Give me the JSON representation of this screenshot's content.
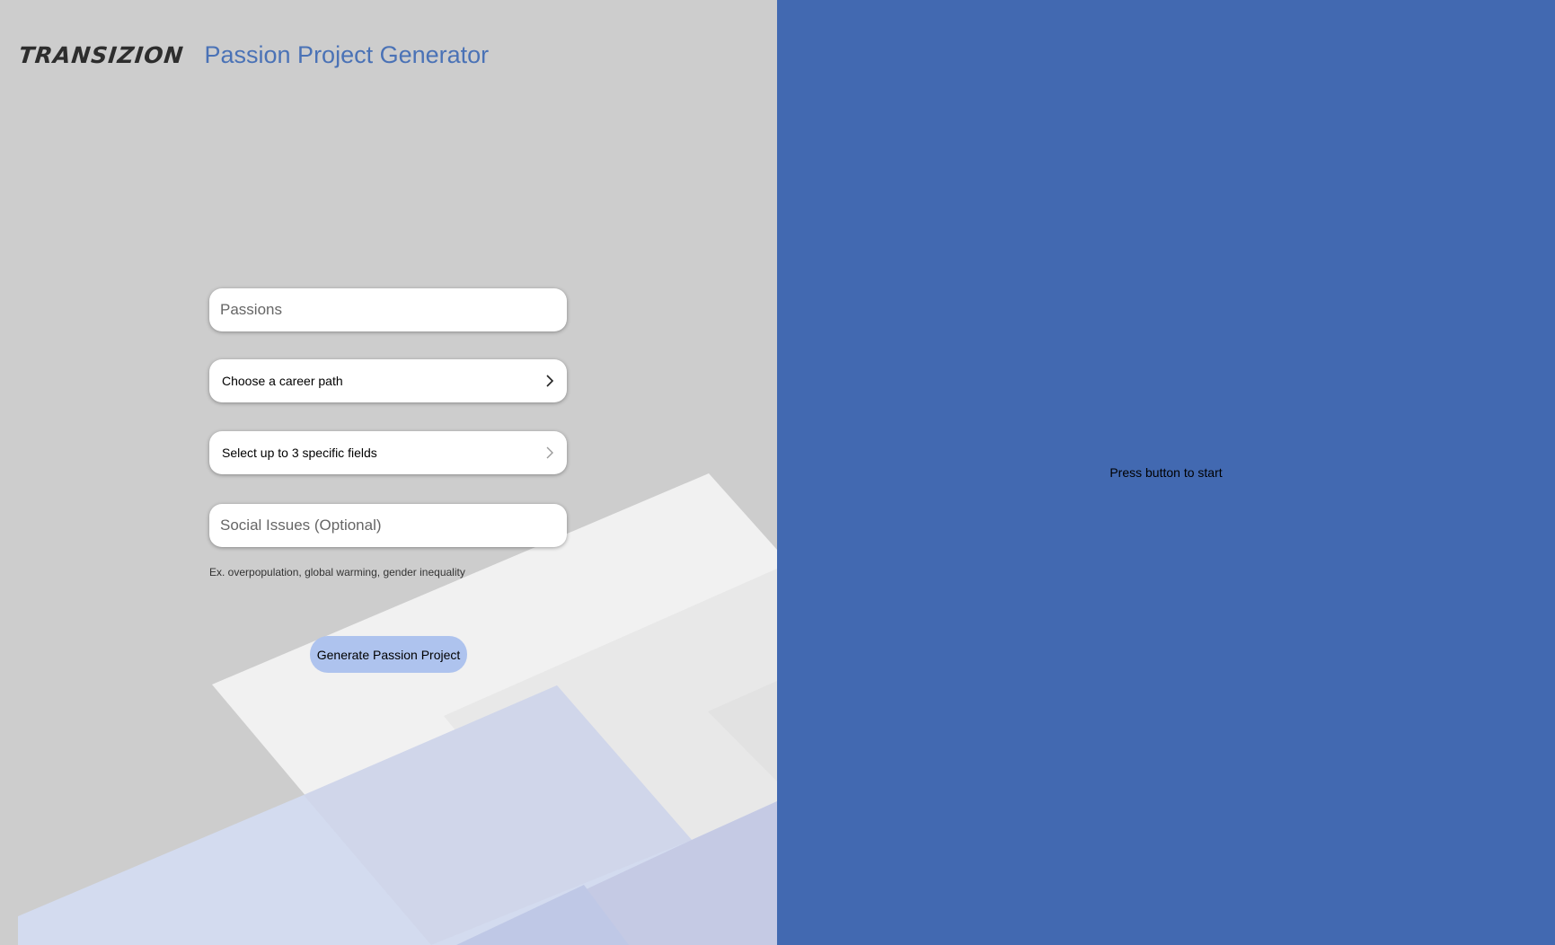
{
  "header": {
    "logo_text": "TRANSIZION",
    "title": "Passion Project Generator"
  },
  "form": {
    "passions": {
      "placeholder": "Passions",
      "value": ""
    },
    "career_path": {
      "label": "Choose a career path"
    },
    "specific_fields": {
      "label": "Select up to 3 specific fields"
    },
    "social_issues": {
      "placeholder": "Social Issues (Optional)",
      "value": ""
    },
    "social_issues_hint": "Ex. overpopulation, global warming, gender inequality",
    "generate_button": "Generate Passion Project"
  },
  "output": {
    "status": "Press button to start"
  },
  "colors": {
    "left_bg": "#cdcdcd",
    "right_bg": "#4269b1",
    "title": "#4a72b6",
    "button": "#aec3ee"
  },
  "icons": {
    "career_path_chevron": "chevron-right-icon",
    "specific_fields_chevron": "chevron-right-icon"
  }
}
